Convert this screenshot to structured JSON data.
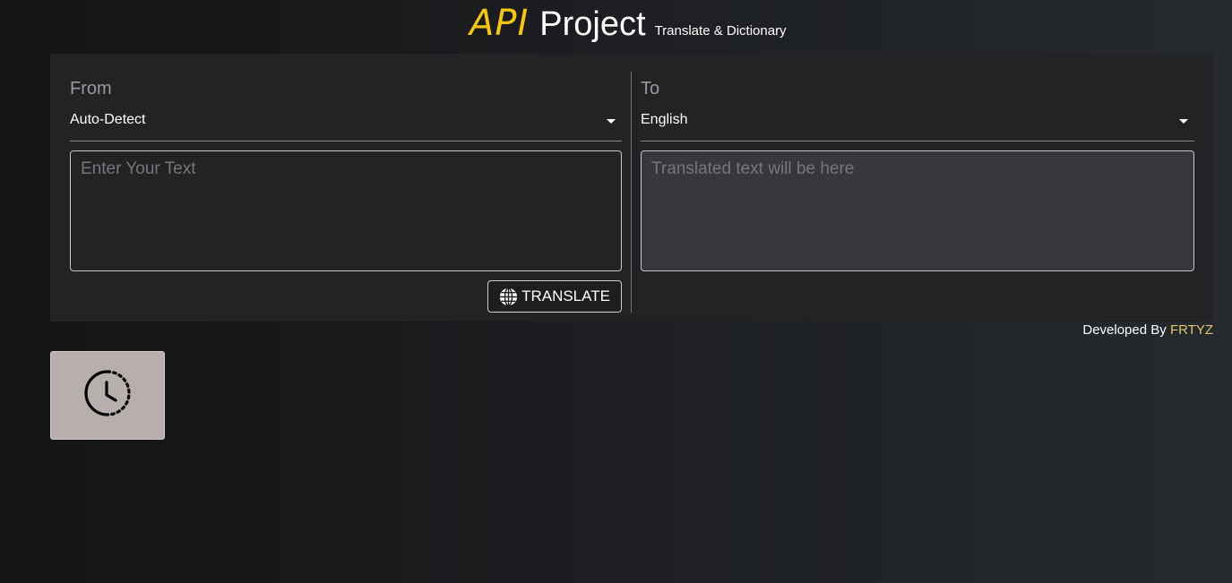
{
  "header": {
    "brand_api": "API",
    "brand_project": "Project",
    "subtitle": "Translate & Dictionary"
  },
  "from": {
    "label": "From",
    "selected": "Auto-Detect",
    "placeholder": "Enter Your Text",
    "value": ""
  },
  "to": {
    "label": "To",
    "selected": "English",
    "placeholder": "Translated text will be here",
    "value": ""
  },
  "translate_button": {
    "label": "TRANSLATE",
    "icon": "globe-icon"
  },
  "footer": {
    "developed_by": "Developed By",
    "author": "FRTYZ"
  },
  "history_button": {
    "icon": "history-clock-icon"
  },
  "colors": {
    "brand_accent": "#f5c518",
    "author_accent": "#e8c46a",
    "panel_bg": "#232325",
    "output_bg": "#38373c",
    "history_bg": "#b7aeae"
  }
}
